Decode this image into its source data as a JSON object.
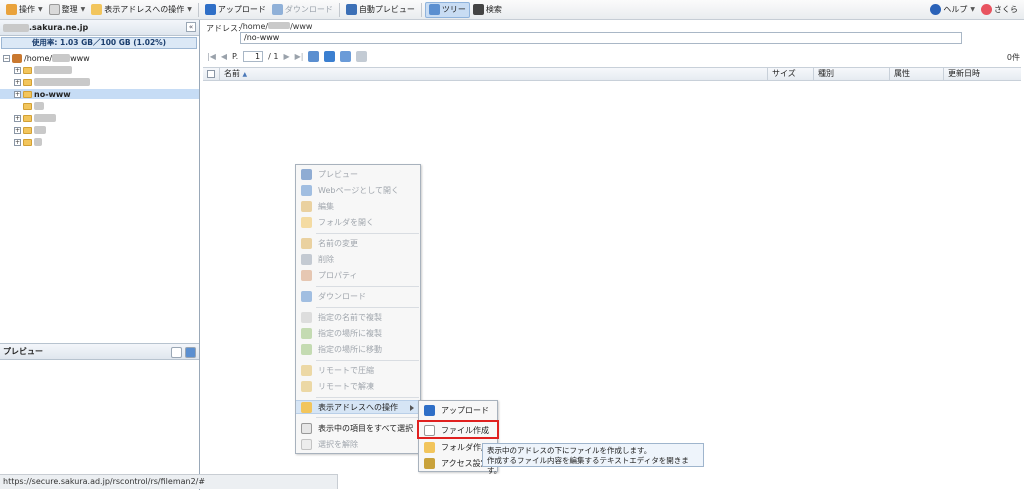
{
  "toolbar": {
    "operate": "操作",
    "organize": "整理",
    "address_ops": "表示アドレスへの操作",
    "upload": "アップロード",
    "download": "ダウンロード",
    "auto_preview": "自動プレビュー",
    "tree": "ツリー",
    "search": "検索",
    "help": "ヘルプ",
    "sakura": "さくら"
  },
  "tree_panel": {
    "domain_suffix": ".sakura.ne.jp",
    "usage": "使用率: 1.03 GB／100 GB (1.02%)",
    "root_prefix": "/home/",
    "root_suffix": "www",
    "selected_folder": "no-www"
  },
  "preview_panel": {
    "title": "プレビュー"
  },
  "address": {
    "label": "アドレス:",
    "line1_prefix": "/home/",
    "line1_suffix": "/www",
    "line2": "/no-www"
  },
  "pager": {
    "prefix": "P.",
    "page": "1",
    "total": "/ 1"
  },
  "item_count": "0件",
  "columns": {
    "name": "名前",
    "size": "サイズ",
    "type": "種別",
    "attr": "属性",
    "modified": "更新日時"
  },
  "context_menu": {
    "preview": "プレビュー",
    "open_web": "Webページとして開く",
    "edit": "編集",
    "open_folder": "フォルダを開く",
    "rename": "名前の変更",
    "delete": "削除",
    "properties": "プロパティ",
    "download": "ダウンロード",
    "copy_named": "指定の名前で複製",
    "copy_location": "指定の場所に複製",
    "move_location": "指定の場所に移動",
    "remote_compress": "リモートで圧縮",
    "remote_extract": "リモートで解凍",
    "address_ops": "表示アドレスへの操作",
    "select_all": "表示中の項目をすべて選択",
    "deselect": "選択を解除"
  },
  "submenu": {
    "upload": "アップロード",
    "create_file": "ファイル作成",
    "create_folder": "フォルダ作成",
    "access_settings": "アクセス設定"
  },
  "tooltip": {
    "line1": "表示中のアドレスの下にファイルを作成します。",
    "line2": "作成するファイル内容を編集するテキストエディタを開きます。"
  },
  "status_url": "https://secure.sakura.ad.jp/rscontrol/rs/fileman2/#"
}
